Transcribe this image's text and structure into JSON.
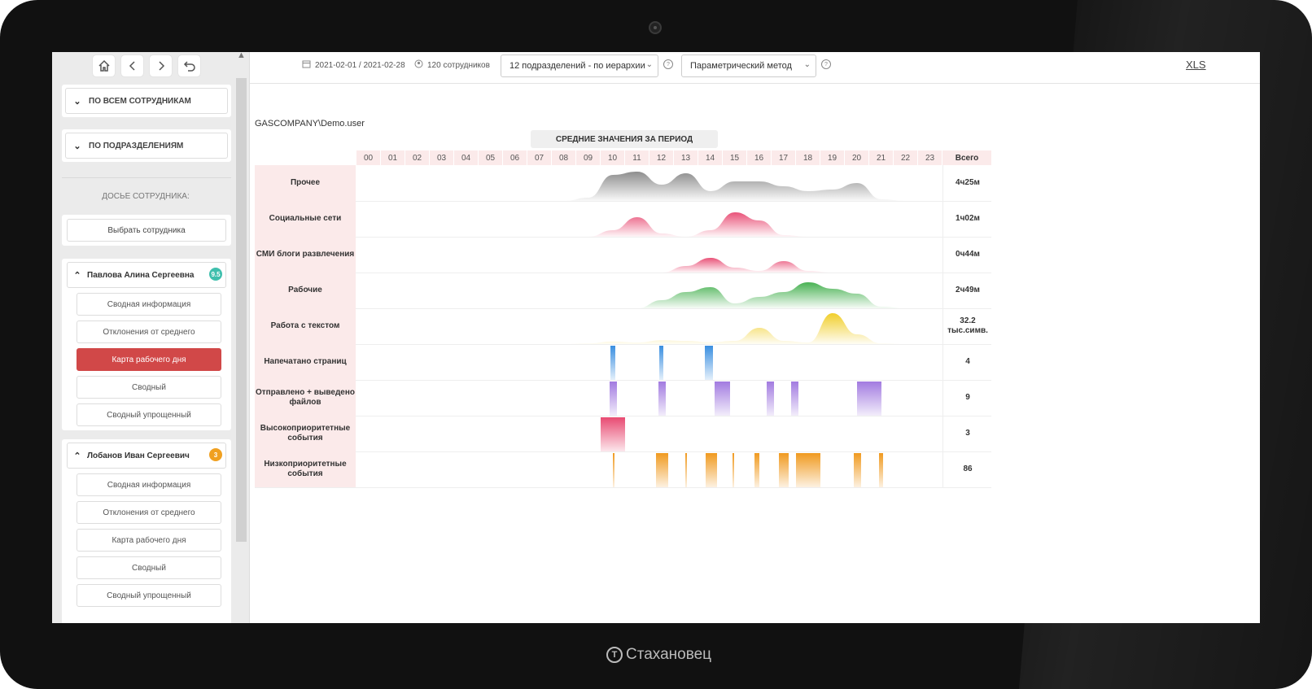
{
  "brand": {
    "name": "Стахановец"
  },
  "nav": {
    "home_icon": "home-icon",
    "back_icon": "chevron-left-icon",
    "forward_icon": "chevron-right-icon",
    "undo_icon": "undo-icon"
  },
  "sidebar": {
    "all_employees": "ПО ВСЕМ СОТРУДНИКАМ",
    "by_departments": "ПО ПОДРАЗДЕЛЕНИЯМ",
    "dossier_label": "ДОСЬЕ СОТРУДНИКА:",
    "choose_employee": "Выбрать сотрудника",
    "employees": [
      {
        "name": "Павлова Алина Сергеевна",
        "badge": "9.5",
        "badge_color": "#3fbfad",
        "items": [
          "Сводная информация",
          "Отклонения от среднего",
          "Карта рабочего дня",
          "Сводный",
          "Сводный упрощенный"
        ],
        "active_index": 2
      },
      {
        "name": "Лобанов Иван Сергеевич",
        "badge": "3",
        "badge_color": "#f0a020",
        "items": [
          "Сводная информация",
          "Отклонения от среднего",
          "Карта рабочего дня",
          "Сводный",
          "Сводный упрощенный"
        ],
        "active_index": -1
      }
    ]
  },
  "topbar": {
    "date_range": "2021-02-01 / 2021-02-28",
    "employees_count": "120 сотрудников",
    "department_select": "12 подразделений - по иерархии",
    "method_select": "Параметрический метод",
    "export": "XLS"
  },
  "main": {
    "user": "GASCOMPANY\\Demo.user",
    "chart_title": "СРЕДНИЕ ЗНАЧЕНИЯ ЗА ПЕРИОД",
    "hours": [
      "00",
      "01",
      "02",
      "03",
      "04",
      "05",
      "06",
      "07",
      "08",
      "09",
      "10",
      "11",
      "12",
      "13",
      "14",
      "15",
      "16",
      "17",
      "18",
      "19",
      "20",
      "21",
      "22",
      "23"
    ],
    "total_header": "Всего"
  },
  "chart_data": {
    "type": "area",
    "x": [
      "00",
      "01",
      "02",
      "03",
      "04",
      "05",
      "06",
      "07",
      "08",
      "09",
      "10",
      "11",
      "12",
      "13",
      "14",
      "15",
      "16",
      "17",
      "18",
      "19",
      "20",
      "21",
      "22",
      "23"
    ],
    "rows": [
      {
        "label": "Прочее",
        "total": "4ч25м",
        "kind": "area",
        "color": "#888888",
        "values": [
          0,
          0,
          0,
          0,
          0,
          0,
          0,
          0,
          0,
          0.1,
          0.8,
          0.9,
          0.5,
          0.85,
          0.3,
          0.6,
          0.6,
          0.45,
          0.3,
          0.35,
          0.55,
          0.05,
          0,
          0
        ]
      },
      {
        "label": "Социальные сети",
        "total": "1ч02м",
        "kind": "area",
        "color": "#e84a72",
        "values": [
          0,
          0,
          0,
          0,
          0,
          0,
          0,
          0,
          0,
          0,
          0.2,
          0.6,
          0.1,
          0,
          0.2,
          0.75,
          0.5,
          0.05,
          0,
          0,
          0,
          0,
          0,
          0
        ]
      },
      {
        "label": "СМИ блоги развлечения",
        "total": "0ч44м",
        "kind": "area",
        "color": "#e84a72",
        "values": [
          0,
          0,
          0,
          0,
          0,
          0,
          0,
          0,
          0,
          0,
          0,
          0,
          0,
          0.2,
          0.45,
          0.15,
          0.05,
          0.35,
          0.05,
          0,
          0,
          0,
          0,
          0
        ]
      },
      {
        "label": "Рабочие",
        "total": "2ч49м",
        "kind": "area",
        "color": "#3fae4a",
        "values": [
          0,
          0,
          0,
          0,
          0,
          0,
          0,
          0,
          0,
          0,
          0,
          0,
          0.25,
          0.5,
          0.65,
          0.15,
          0.35,
          0.5,
          0.8,
          0.6,
          0.45,
          0.05,
          0,
          0
        ]
      },
      {
        "label": "Работа с текстом",
        "total": "32.2 тыс.симв.",
        "kind": "area",
        "color": "#f0cc20",
        "values": [
          0,
          0,
          0,
          0,
          0,
          0,
          0,
          0,
          0,
          0.02,
          0.08,
          0.05,
          0.12,
          0.1,
          0.06,
          0.1,
          0.5,
          0.1,
          0.05,
          0.95,
          0.3,
          0.02,
          0,
          0
        ]
      },
      {
        "label": "Напечатано страниц",
        "total": "4",
        "kind": "bars",
        "color": "#3a8fe0",
        "bars": [
          {
            "x": 10.4,
            "w": 0.2
          },
          {
            "x": 12.4,
            "w": 0.15
          },
          {
            "x": 14.25,
            "w": 0.35
          }
        ]
      },
      {
        "label": "Отправлено + выведено файлов",
        "total": "9",
        "kind": "bars",
        "color": "#a27be0",
        "bars": [
          {
            "x": 10.35,
            "w": 0.3
          },
          {
            "x": 12.35,
            "w": 0.3
          },
          {
            "x": 14.65,
            "w": 0.65
          },
          {
            "x": 16.8,
            "w": 0.3
          },
          {
            "x": 17.8,
            "w": 0.3
          },
          {
            "x": 20.5,
            "w": 1.0
          }
        ]
      },
      {
        "label": "Высокоприоритетные события",
        "total": "3",
        "kind": "bars",
        "color": "#e84a72",
        "bars": [
          {
            "x": 10.0,
            "w": 1.0
          }
        ]
      },
      {
        "label": "Низкоприоритетные события",
        "total": "86",
        "kind": "bars",
        "color": "#f09a20",
        "bars": [
          {
            "x": 10.5,
            "w": 0.08
          },
          {
            "x": 12.25,
            "w": 0.5
          },
          {
            "x": 13.45,
            "w": 0.08
          },
          {
            "x": 14.3,
            "w": 0.45
          },
          {
            "x": 15.4,
            "w": 0.08
          },
          {
            "x": 16.3,
            "w": 0.2
          },
          {
            "x": 17.3,
            "w": 0.4
          },
          {
            "x": 18.0,
            "w": 1.0
          },
          {
            "x": 20.35,
            "w": 0.3
          },
          {
            "x": 21.4,
            "w": 0.15
          }
        ]
      }
    ]
  }
}
